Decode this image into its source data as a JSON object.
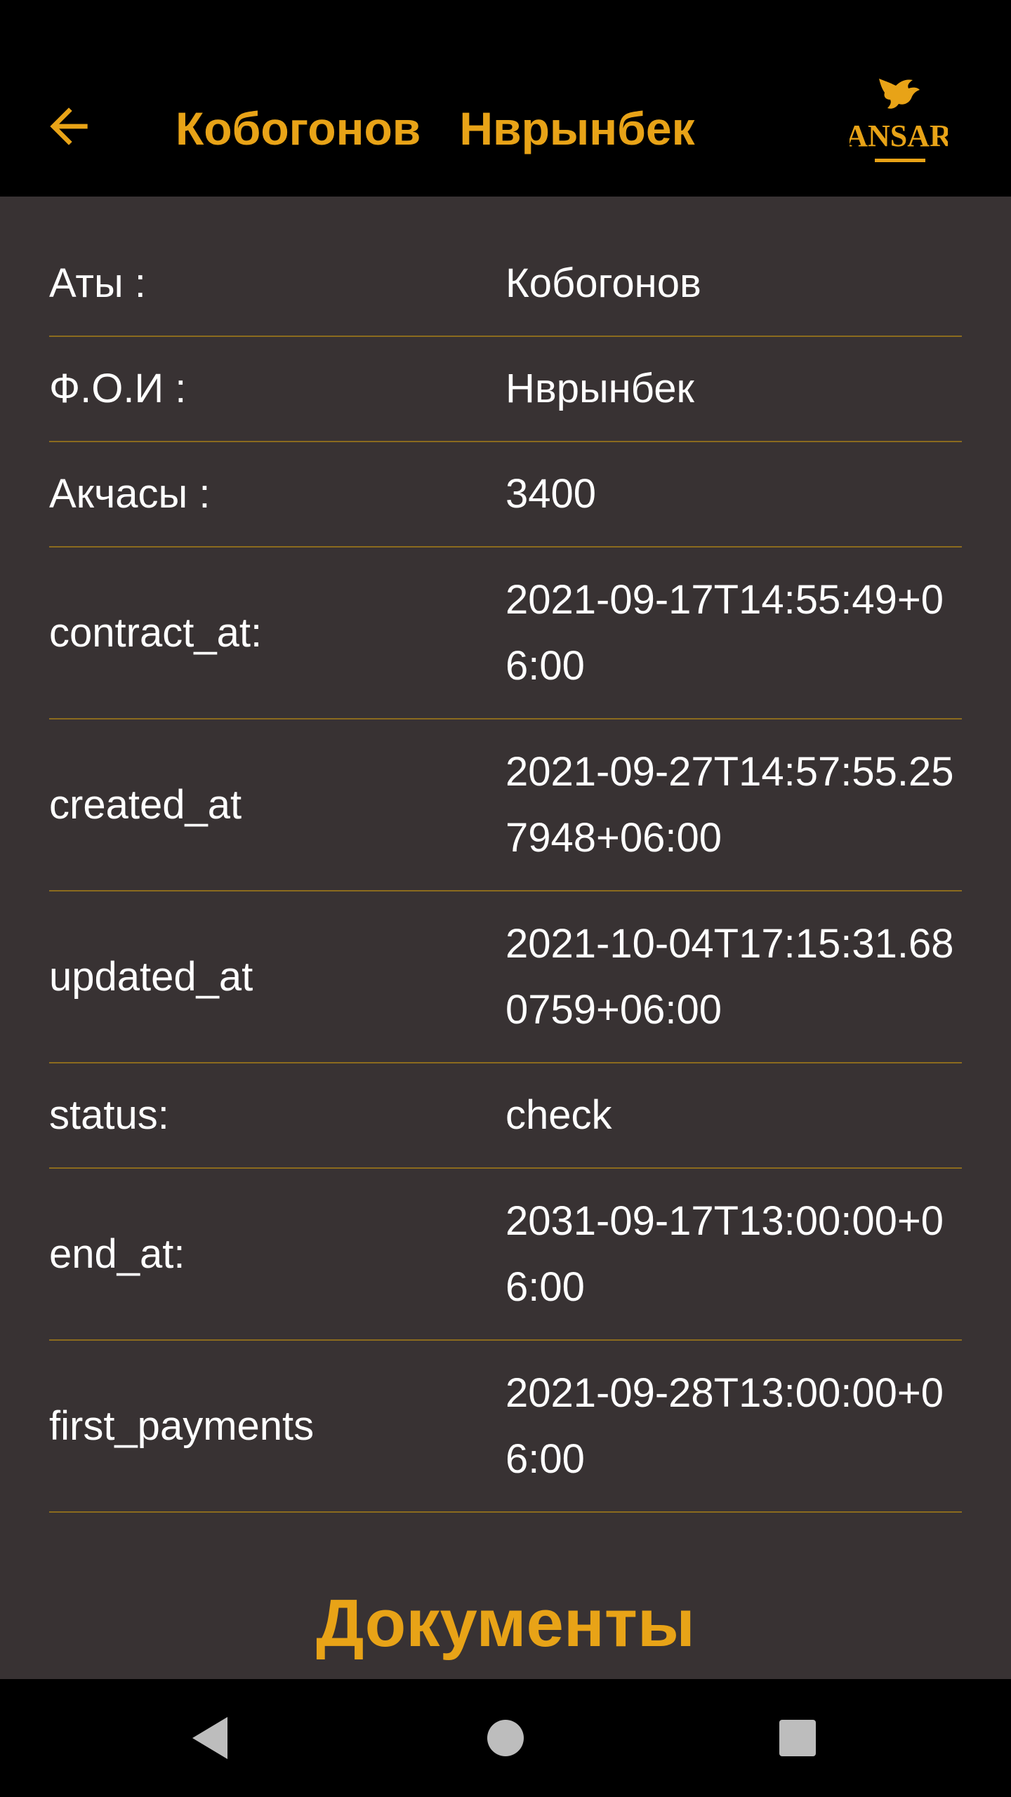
{
  "app_bar": {
    "title": "Кобогонов   Нврынбек",
    "logo_text": "ANSAR",
    "back_icon": "arrow-left-icon"
  },
  "details": {
    "rows": [
      {
        "label": "Аты :",
        "value": "Кобогонов"
      },
      {
        "label": "Ф.О.И :",
        "value": "Нврынбек"
      },
      {
        "label": "Акчасы :",
        "value": "3400"
      },
      {
        "label": "contract_at:",
        "value": "2021-09-17T14:55:49+06:00"
      },
      {
        "label": "created_at",
        "value": "2021-09-27T14:57:55.257948+06:00"
      },
      {
        "label": "updated_at",
        "value": "2021-10-04T17:15:31.680759+06:00"
      },
      {
        "label": "status:",
        "value": "check"
      },
      {
        "label": "end_at:",
        "value": "2031-09-17T13:00:00+06:00"
      },
      {
        "label": "first_payments",
        "value": "2021-09-28T13:00:00+06:00"
      }
    ]
  },
  "documents_heading": "Документы",
  "nav_bar": {
    "back": "triangle-back-icon",
    "home": "circle-home-icon",
    "recents": "square-recents-icon"
  },
  "colors": {
    "accent": "#E8A317",
    "background": "#383233",
    "bar": "#000000",
    "divider": "#8B6B1E",
    "nav_icon": "#BDBDBD"
  }
}
